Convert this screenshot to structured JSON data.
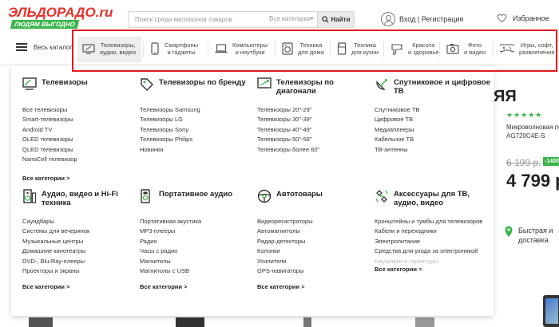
{
  "header": {
    "logo_text": "ЭЛЬДОРАДО.ru",
    "logo_tagline": "ЛЮДЯМ ВЫГОДНО",
    "search_placeholder": "Поиск среди миллионов товаров",
    "search_category": "Все категории",
    "search_button": "Найти",
    "login": "Вход | Регистрация",
    "favorites": "Избранное"
  },
  "nav": {
    "catalog": "Весь каталог",
    "items": [
      {
        "label": "Телевизоры,\nаудио, видео",
        "icon": "tv-audio-icon"
      },
      {
        "label": "Смартфоны\nи гаджеты",
        "icon": "smartphone-icon"
      },
      {
        "label": "Компьютеры\nи ноутбуки",
        "icon": "laptop-icon"
      },
      {
        "label": "Техника\nдля дома",
        "icon": "washing-machine-icon"
      },
      {
        "label": "Техника\nдля кухни",
        "icon": "fridge-icon"
      },
      {
        "label": "Красота\nи здоровье",
        "icon": "hair-dryer-icon"
      },
      {
        "label": "Фото\nи видео",
        "icon": "camera-icon"
      },
      {
        "label": "Игры, софт,\nразвлечения",
        "icon": "gamepad-icon"
      }
    ]
  },
  "menu": {
    "groups": [
      {
        "title": "Телевизоры",
        "icon": "tv-icon",
        "links": [
          "Все телевизоры",
          "Smart-телевизоры",
          "Android TV",
          "OLED телевизоры",
          "QLED телевизоры",
          "NanoCell телевизор"
        ],
        "all": "Все категории >"
      },
      {
        "title": "Телевизоры по бренду",
        "icon": "tag-icon",
        "links": [
          "Телевизоры Samsung",
          "Телевизоры LG",
          "Телевизоры Sony",
          "Телевизоры Philips",
          "Новинки"
        ]
      },
      {
        "title": "Телевизоры по диагонали",
        "icon": "diagonal-icon",
        "links": [
          "Телевизоры 20\"-29\"",
          "Телевизоры 30\"-39\"",
          "Телевизоры 40\"-49\"",
          "Телевизоры 50\"-58\"",
          "Телевизоры более 60\""
        ]
      },
      {
        "title": "Спутниковое и цифровое ТВ",
        "icon": "satellite-icon",
        "links": [
          "Спутниковое ТВ",
          "Цифровое ТВ",
          "Медиаплееры",
          "Кабельное ТВ",
          "ТВ-антенны"
        ]
      },
      {
        "title": "Аудио, видео и Hi-Fi техника",
        "icon": "speaker-icon",
        "links": [
          "Саундбары",
          "Системы для вечеринок",
          "Музыкальные центры",
          "Домашние кинотеатры",
          "DVD-, Blu-Ray-плееры",
          "Проекторы и экраны"
        ],
        "all": "Все категории >"
      },
      {
        "title": "Портативное аудио",
        "icon": "portable-audio-icon",
        "links": [
          "Портативная акустика",
          "MP3-плееры",
          "Радио",
          "Часы с радио",
          "Магнитолы",
          "Магнитолы с USB"
        ],
        "all": "Все категории >"
      },
      {
        "title": "Автотовары",
        "icon": "steering-wheel-icon",
        "links": [
          "Видеорегистраторы",
          "Автомагнитолы",
          "Радар-детекторы",
          "Колонки",
          "Усилители",
          "GPS-навигаторы"
        ],
        "all": "Все категории >"
      },
      {
        "title": "Аксессуары для ТВ, аудио, видео",
        "icon": "accessories-icon",
        "links": [
          "Кронштейны и тумбы для телевизоров",
          "Кабели и переходники",
          "Электропитание",
          "Средства для ухода за электроникой",
          "Наушники и гарнитуры"
        ],
        "all": "Все категории >"
      }
    ]
  },
  "background": {
    "heading_fragment": "ЯЯ",
    "stars": "★★★★★",
    "product_desc": "Микроволновая пе AG720C4E-S",
    "old_price": "6 199 р.",
    "discount": "-1400",
    "price": "4 799 р.",
    "delivery": "Быстрая и доставка"
  },
  "colors": {
    "brand_red": "#e8312a",
    "brand_green": "#3ab54a",
    "highlight": "#e3161c"
  }
}
